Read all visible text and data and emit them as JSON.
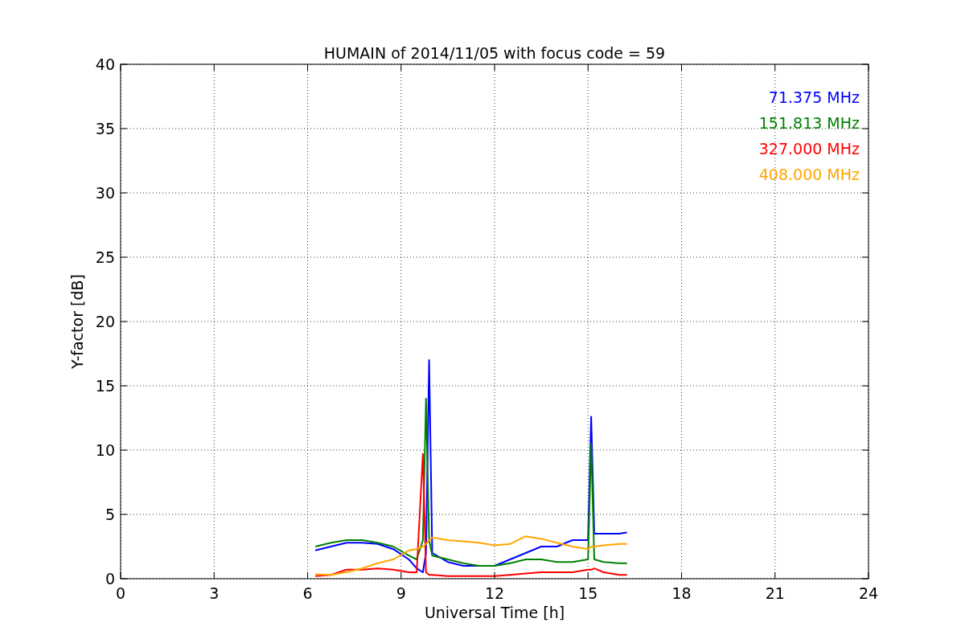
{
  "figure": {
    "chart_data": {
      "type": "line",
      "title": "HUMAIN of 2014/11/05 with focus code = 59",
      "xlabel": "Universal Time [h]",
      "ylabel": "Y-factor [dB]",
      "grid": true,
      "xlim": [
        0,
        24
      ],
      "ylim": [
        0,
        40
      ],
      "xticks": [
        0,
        3,
        6,
        9,
        12,
        15,
        18,
        21,
        24
      ],
      "yticks": [
        0,
        5,
        10,
        15,
        20,
        25,
        30,
        35,
        40
      ],
      "x": [
        6.25,
        6.75,
        7.25,
        7.75,
        8.25,
        8.75,
        9.25,
        9.5,
        9.7,
        9.8,
        9.9,
        10.0,
        10.5,
        11,
        11.5,
        12,
        12.5,
        13,
        13.5,
        14,
        14.5,
        15,
        15.1,
        15.2,
        15.5,
        16,
        16.25
      ],
      "series": [
        {
          "name": "71.375 MHz",
          "color": "#0000ff",
          "values": [
            2.2,
            2.5,
            2.8,
            2.8,
            2.7,
            2.3,
            1.5,
            0.8,
            0.5,
            2,
            17,
            2,
            1.3,
            1.0,
            1.0,
            1.0,
            1.5,
            2,
            2.5,
            2.5,
            3,
            3,
            12.6,
            3.5,
            3.5,
            3.5,
            3.6
          ]
        },
        {
          "name": "151.813 MHz",
          "color": "#008000",
          "values": [
            2.5,
            2.8,
            3,
            3,
            2.8,
            2.5,
            1.8,
            1.5,
            3,
            14,
            3,
            1.8,
            1.5,
            1.2,
            1.0,
            1.0,
            1.2,
            1.5,
            1.5,
            1.3,
            1.3,
            1.5,
            10.5,
            1.5,
            1.3,
            1.2,
            1.2
          ]
        },
        {
          "name": "327.000 MHz",
          "color": "#ff0000",
          "values": [
            0.2,
            0.3,
            0.7,
            0.7,
            0.8,
            0.7,
            0.5,
            0.5,
            9.7,
            0.5,
            0.3,
            0.3,
            0.2,
            0.2,
            0.2,
            0.2,
            0.3,
            0.4,
            0.5,
            0.5,
            0.5,
            0.7,
            0.7,
            0.8,
            0.5,
            0.3,
            0.3
          ]
        },
        {
          "name": "408.000 MHz",
          "color": "#ffa500",
          "values": [
            0.35,
            0.3,
            0.5,
            0.8,
            1.2,
            1.5,
            2.2,
            2.3,
            2.5,
            2.7,
            3,
            3.2,
            3,
            2.9,
            2.8,
            2.6,
            2.7,
            3.3,
            3.1,
            2.8,
            2.5,
            2.3,
            2.5,
            2.5,
            2.6,
            2.7,
            2.7
          ]
        }
      ]
    }
  }
}
